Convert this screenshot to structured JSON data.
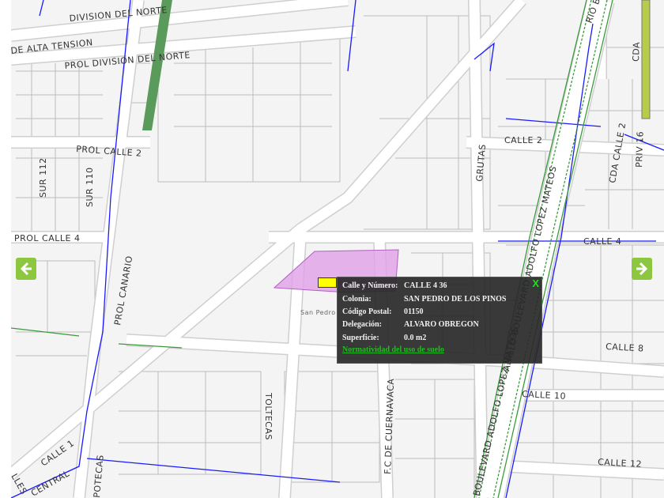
{
  "colors": {
    "parcel": "#e0a0e8",
    "boundary": "#1a1aff",
    "rail": "#3a9a3a",
    "nav": "#8dc63f"
  },
  "streets": {
    "division_norte": "DIVISION DEL NORTE",
    "alta_tension": "DE ALTA TENSION",
    "prol_division": "PROL DIVISION DEL NORTE",
    "prol_calle2": "PROL CALLE 2",
    "sur112": "SUR 112",
    "sur110": "SUR 110",
    "prol_calle4": "PROL CALLE 4",
    "prol_canario": "PROL CANARIO",
    "calle1": "CALLE 1",
    "calles": "LLES",
    "central": "CENTRAL",
    "potecas": "POTECAS",
    "toltecas": "TOLTECAS",
    "fc_cuernavaca": "F.C DE CUERNAVACA",
    "grutas": "GRUTAS",
    "calle2": "CALLE 2",
    "calle4": "CALLE 4",
    "calle8": "CALLE 8",
    "calle10": "CALLE 10",
    "calle12": "CALLE 12",
    "anillo": "ANILLO BOULEVARD ADOLFO LOPEZ MATEOS",
    "boulevard": "BOULEVARD ADOLFO LOPEZ MATEOS",
    "cda_calle2": "CDA CALLE 2",
    "priv16": "PRIV 16",
    "rio": "RIO BEC",
    "cda": "CDA",
    "san_pedro": "San Pedro"
  },
  "nav": {
    "left_icon": "arrow-left-icon",
    "right_icon": "arrow-right-icon"
  },
  "popup": {
    "close": "X",
    "fields": [
      {
        "label": "Calle y Número:",
        "value": "CALLE 4 36"
      },
      {
        "label": "Colonia:",
        "value": "SAN PEDRO DE LOS PINOS"
      },
      {
        "label": "Código Postal:",
        "value": "01150"
      },
      {
        "label": "Delegación:",
        "value": "ALVARO OBREGON"
      },
      {
        "label": "Superficie:",
        "value": "0.0 m2"
      }
    ],
    "link": "Normatividad del uso de suelo"
  }
}
